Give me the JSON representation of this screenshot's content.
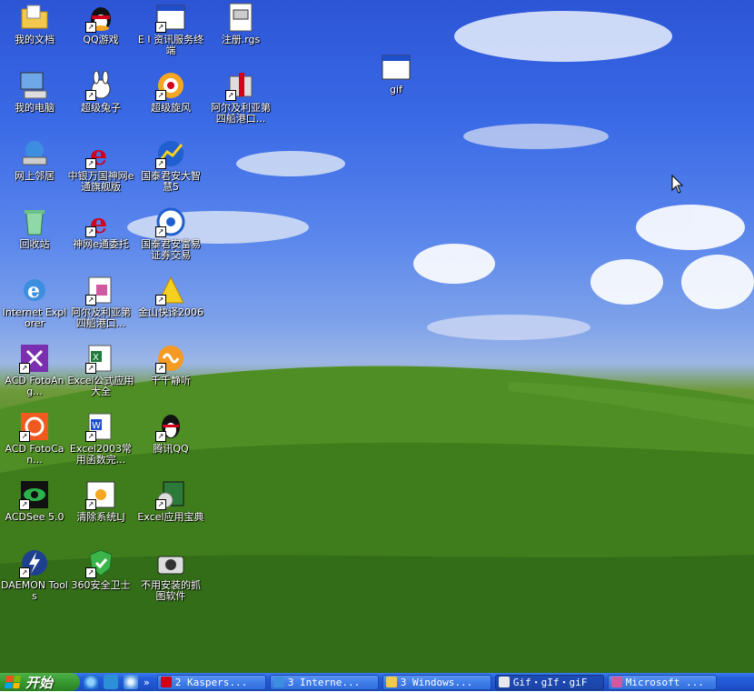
{
  "desktop_icons": [
    {
      "id": "my-documents",
      "label": "我的文档",
      "icon": "folder-documents-icon",
      "shortcut": false
    },
    {
      "id": "qq-game",
      "label": "QQ游戏",
      "icon": "qq-game-icon",
      "shortcut": true
    },
    {
      "id": "ei-terminal",
      "label": "E I 资讯服务终端",
      "icon": "window-app-icon",
      "shortcut": true
    },
    {
      "id": "register-rgs",
      "label": "注册.rgs",
      "icon": "registry-file-icon",
      "shortcut": false
    },
    {
      "id": "my-computer",
      "label": "我的电脑",
      "icon": "computer-icon",
      "shortcut": false
    },
    {
      "id": "super-rabbit",
      "label": "超级兔子",
      "icon": "rabbit-icon",
      "shortcut": true
    },
    {
      "id": "super-whirlwind",
      "label": "超级旋风",
      "icon": "whirlwind-icon",
      "shortcut": true
    },
    {
      "id": "algeria-1",
      "label": "阿尔及利亚第四船港口...",
      "icon": "installer-package-icon",
      "shortcut": true
    },
    {
      "id": "network",
      "label": "网上邻居",
      "icon": "network-places-icon",
      "shortcut": false
    },
    {
      "id": "cyber-trade",
      "label": "中银万国神网e通旗舰版",
      "icon": "ie-app-icon",
      "shortcut": true
    },
    {
      "id": "guotai-smart",
      "label": "国泰君安大智慧5",
      "icon": "chart-app-icon",
      "shortcut": true
    },
    {
      "id": "gif-window",
      "label": "gif",
      "icon": "window-app-icon",
      "shortcut": false
    },
    {
      "id": "recycle-bin",
      "label": "回收站",
      "icon": "recycle-bin-icon",
      "shortcut": false
    },
    {
      "id": "shenwang-e",
      "label": "神网e通委托",
      "icon": "ie-app-icon",
      "shortcut": true
    },
    {
      "id": "guotai-rich",
      "label": "国泰君安富易证券交易",
      "icon": "trading-app-icon",
      "shortcut": true
    },
    {
      "id": "internet-explorer",
      "label": "Internet Explorer",
      "icon": "internet-explorer-icon",
      "shortcut": false
    },
    {
      "id": "algeria-2",
      "label": "阿尔及利亚第四船港口...",
      "icon": "document-package-icon",
      "shortcut": true
    },
    {
      "id": "kingsoft-translate",
      "label": "金山快译2006",
      "icon": "kingsoft-icon",
      "shortcut": true
    },
    {
      "id": "acd-fotoang",
      "label": "ACD FotoAng...",
      "icon": "acd-fotoangelo-icon",
      "shortcut": true
    },
    {
      "id": "excel-formula",
      "label": "Excel公式应用大全",
      "icon": "excel-doc-icon",
      "shortcut": true
    },
    {
      "id": "ttplayer",
      "label": "千千静听",
      "icon": "ttplayer-icon",
      "shortcut": true
    },
    {
      "id": "acd-fotocan",
      "label": "ACD FotoCan...",
      "icon": "acd-fotocanvas-icon",
      "shortcut": true
    },
    {
      "id": "excel2003",
      "label": "Excel2003常用函数完...",
      "icon": "word-doc-icon",
      "shortcut": true
    },
    {
      "id": "tencent-qq",
      "label": "腾讯QQ",
      "icon": "qq-penguin-icon",
      "shortcut": true
    },
    {
      "id": "acdsee",
      "label": "ACDSee 5.0",
      "icon": "acdsee-eye-icon",
      "shortcut": true
    },
    {
      "id": "clean-junk",
      "label": "清除系统LJ",
      "icon": "cleaner-icon",
      "shortcut": true
    },
    {
      "id": "excel-treasure",
      "label": "Excel应用宝典",
      "icon": "book-cd-icon",
      "shortcut": true
    },
    {
      "id": "daemon-tools",
      "label": "DAEMON Tools",
      "icon": "daemon-tools-icon",
      "shortcut": true
    },
    {
      "id": "360-safe",
      "label": "360安全卫士",
      "icon": "shield-360-icon",
      "shortcut": true
    },
    {
      "id": "screenshot-tool",
      "label": "不用安装的抓图软件",
      "icon": "camera-icon",
      "shortcut": false
    }
  ],
  "taskbar": {
    "start_label": "开始",
    "quick_launch_more": "»",
    "tasks": [
      {
        "label": "2 Kaspers...",
        "icon": "kaspersky-icon",
        "active": false
      },
      {
        "label": "3 Interne...",
        "icon": "internet-explorer-icon",
        "active": false
      },
      {
        "label": "3 Windows...",
        "icon": "folder-icon",
        "active": false
      },
      {
        "label": "Gif・gIf・giF",
        "icon": "gif-app-icon",
        "active": true
      },
      {
        "label": "Microsoft ...",
        "icon": "office-icon",
        "active": false
      }
    ]
  },
  "colors": {
    "taskbar_blue": "#245edb",
    "start_green": "#379a2f",
    "sky_blue": "#3a6ae6",
    "grass_green": "#4f8a22"
  }
}
